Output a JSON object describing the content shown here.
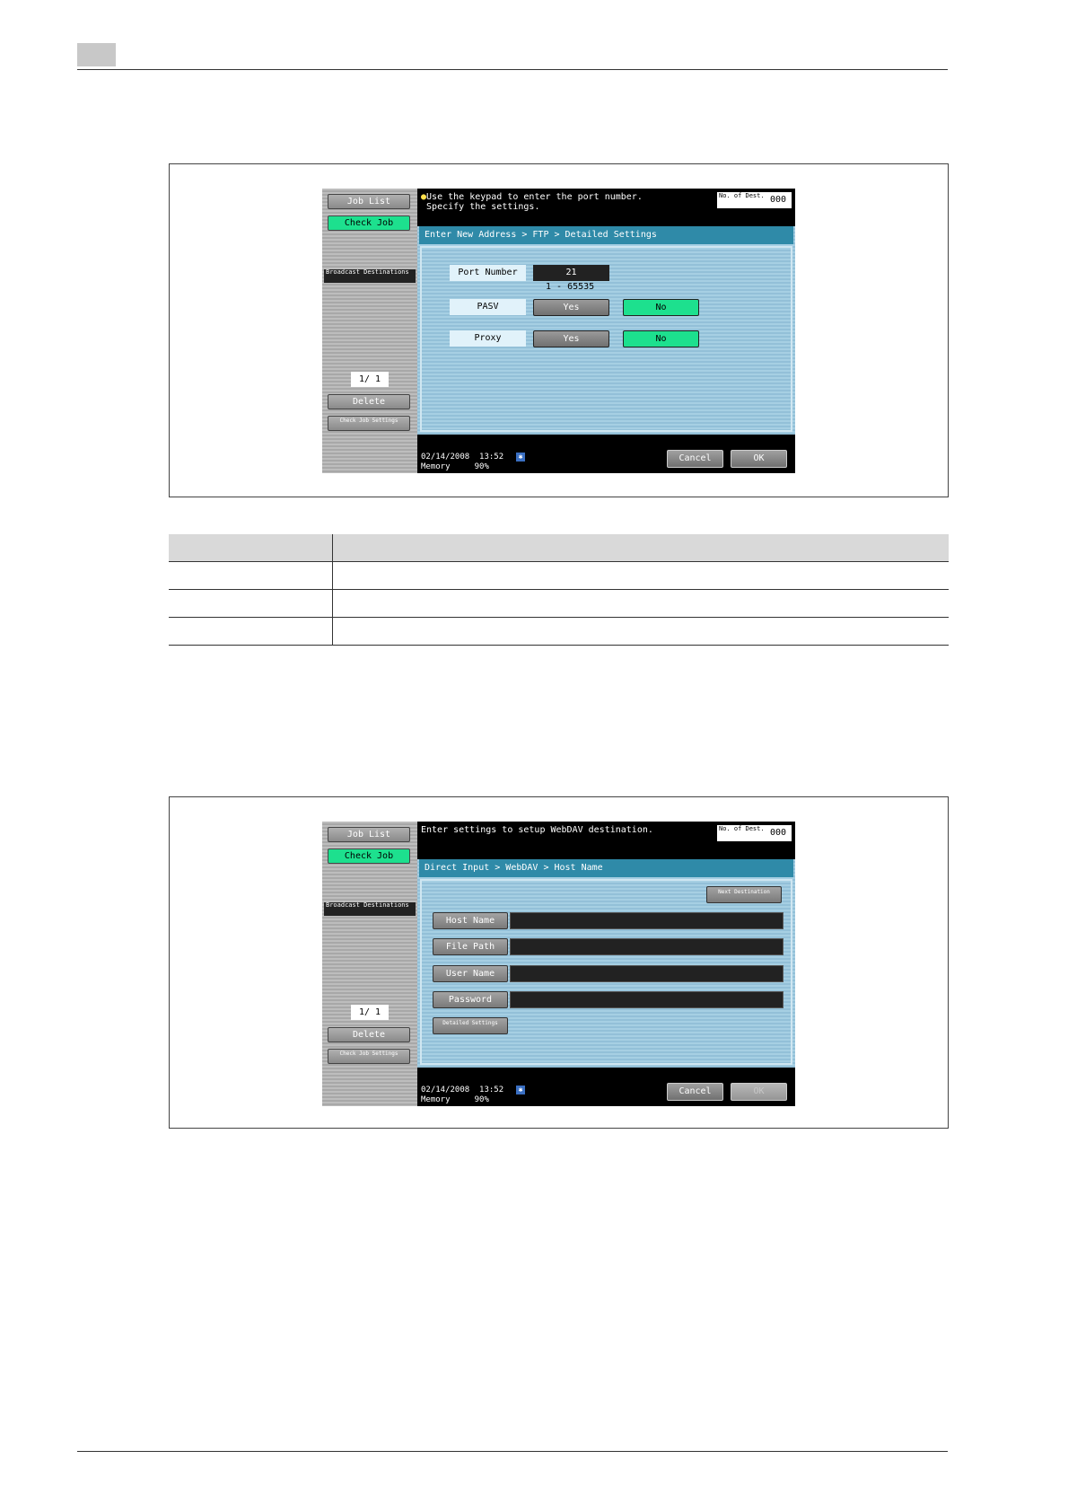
{
  "screen1": {
    "left_panel": {
      "job_list": "Job List",
      "check_job": "Check Job",
      "broadcast": "Broadcast Destinations",
      "page": "1/ 1",
      "delete": "Delete",
      "check_job_settings": "Check Job Settings"
    },
    "message_line1": "Use the keypad to enter the port number.",
    "message_line2": "Specify the settings.",
    "dest_label": "No. of Dest.",
    "dest_count": "000",
    "breadcrumb": "Enter New Address > FTP > Detailed Settings",
    "port_number_label": "Port Number",
    "port_number_value": "21",
    "port_range": "1 - 65535",
    "pasv_label": "PASV",
    "proxy_label": "Proxy",
    "yes": "Yes",
    "no": "No",
    "date": "02/14/2008",
    "time": "13:52",
    "memory_label": "Memory",
    "memory_value": "90%",
    "cancel": "Cancel",
    "ok": "OK"
  },
  "screen2": {
    "left_panel": {
      "job_list": "Job List",
      "check_job": "Check Job",
      "broadcast": "Broadcast Destinations",
      "page": "1/ 1",
      "delete": "Delete",
      "check_job_settings": "Check Job Settings"
    },
    "message": "Enter settings to setup WebDAV destination.",
    "dest_label": "No. of Dest.",
    "dest_count": "000",
    "breadcrumb": "Direct Input > WebDAV > Host Name",
    "next_destination": "Next Destination",
    "host_name": "Host Name",
    "file_path": "File Path",
    "user_name": "User Name",
    "password": "Password",
    "detailed_settings": "Detailed Settings",
    "date": "02/14/2008",
    "time": "13:52",
    "memory_label": "Memory",
    "memory_value": "90%",
    "cancel": "Cancel",
    "ok": "OK"
  },
  "colors": {
    "accent_green": "#1de08e",
    "breadcrumb_blue": "#2f8aa8",
    "panel_blue": "#a6cfe3"
  }
}
